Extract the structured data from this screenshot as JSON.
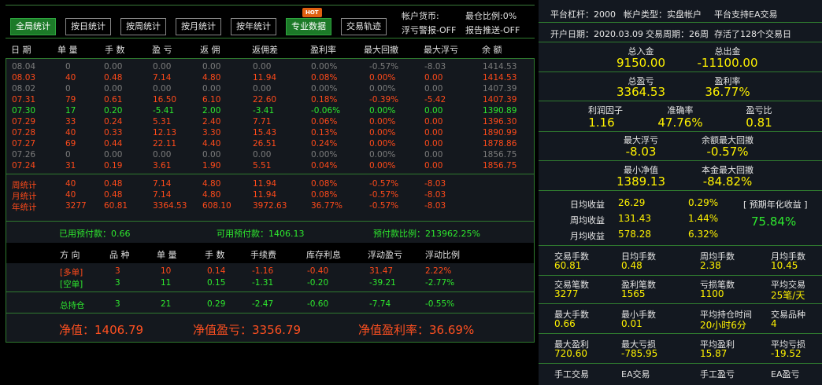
{
  "toolbar": {
    "buttons": [
      "全局统计",
      "按日统计",
      "按周统计",
      "按月统计",
      "按年统计",
      "专业数据",
      "交易轨迹"
    ],
    "hot_badge": "HOT",
    "account_currency": "帐户货币:",
    "min_position_ratio": "最仓比例:0%",
    "floating_loss_alert": "浮亏警报-OFF",
    "report_push": "报告推送-OFF"
  },
  "main_headers": [
    "日 期",
    "单 量",
    "手 数",
    "盈 亏",
    "返 佣",
    "返佣差",
    "盈利率",
    "最大回撤",
    "最大浮亏",
    "余 额"
  ],
  "daily_rows": [
    {
      "tone": "c-gray",
      "cells": [
        "08.04",
        "0",
        "0.00",
        "0.00",
        "0.00",
        "0.00",
        "0.00%",
        "-0.57%",
        "-8.03",
        "1414.53"
      ]
    },
    {
      "tone": "c-red",
      "cells": [
        "08.03",
        "40",
        "0.48",
        "7.14",
        "4.80",
        "11.94",
        "0.08%",
        "0.00%",
        "0.00",
        "1414.53"
      ]
    },
    {
      "tone": "c-gray",
      "cells": [
        "08.02",
        "0",
        "0.00",
        "0.00",
        "0.00",
        "0.00",
        "0.00%",
        "0.00%",
        "0.00",
        "1407.39"
      ]
    },
    {
      "tone": "c-red",
      "cells": [
        "07.31",
        "79",
        "0.61",
        "16.50",
        "6.10",
        "22.60",
        "0.18%",
        "-0.39%",
        "-5.42",
        "1407.39"
      ]
    },
    {
      "tone": "c-green",
      "cells": [
        "07.30",
        "17",
        "0.20",
        "-5.41",
        "2.00",
        "-3.41",
        "-0.06%",
        "0.00%",
        "0.00",
        "1390.89"
      ]
    },
    {
      "tone": "c-red",
      "cells": [
        "07.29",
        "33",
        "0.24",
        "5.31",
        "2.40",
        "7.71",
        "0.06%",
        "0.00%",
        "0.00",
        "1396.30"
      ]
    },
    {
      "tone": "c-red",
      "cells": [
        "07.28",
        "40",
        "0.33",
        "12.13",
        "3.30",
        "15.43",
        "0.13%",
        "0.00%",
        "0.00",
        "1890.99"
      ]
    },
    {
      "tone": "c-red",
      "cells": [
        "07.27",
        "69",
        "0.44",
        "22.11",
        "4.40",
        "26.51",
        "0.24%",
        "0.00%",
        "0.00",
        "1878.86"
      ]
    },
    {
      "tone": "c-gray",
      "cells": [
        "07.26",
        "0",
        "0.00",
        "0.00",
        "0.00",
        "0.00",
        "0.00%",
        "0.00%",
        "0.00",
        "1856.75"
      ]
    },
    {
      "tone": "c-red",
      "cells": [
        "07.24",
        "31",
        "0.19",
        "3.61",
        "1.90",
        "5.51",
        "0.04%",
        "0.00%",
        "0.00",
        "1856.75"
      ]
    }
  ],
  "summary_rows": [
    {
      "cells": [
        "周统计",
        "40",
        "0.48",
        "7.14",
        "4.80",
        "11.94",
        "0.08%",
        "-0.57%",
        "-8.03"
      ]
    },
    {
      "cells": [
        "月统计",
        "40",
        "0.48",
        "7.14",
        "4.80",
        "11.94",
        "0.08%",
        "-0.57%",
        "-8.03"
      ]
    },
    {
      "cells": [
        "年统计",
        "3277",
        "60.81",
        "3364.53",
        "608.10",
        "3972.63",
        "36.77%",
        "-0.57%",
        "-8.03"
      ]
    }
  ],
  "prepayment": {
    "used": "已用预付款：0.66",
    "available": "可用预付款：1406.13",
    "ratio": "预付款比例：213962.25%"
  },
  "position_headers": [
    "方 向",
    "品 种",
    "单 量",
    "手 数",
    "手续费",
    "库存利息",
    "浮动盈亏",
    "浮动比例"
  ],
  "position_rows": [
    {
      "tone": "c-red",
      "cells": [
        "[多单]",
        "3",
        "10",
        "0.14",
        "-1.16",
        "-0.40",
        "31.47",
        "2.22%"
      ]
    },
    {
      "tone": "c-green",
      "cells": [
        "[空单]",
        "3",
        "11",
        "0.15",
        "-1.31",
        "-0.20",
        "-39.21",
        "-2.77%"
      ]
    }
  ],
  "position_total": {
    "tone": "c-green",
    "cells": [
      "总持仓",
      "3",
      "21",
      "0.29",
      "-2.47",
      "-0.60",
      "-7.74",
      "-0.55%"
    ]
  },
  "net": {
    "value": "净值：1406.79",
    "pnl": "净值盈亏：3356.79",
    "rate": "净值盈利率：36.69%"
  },
  "right": {
    "leverage": "平台杠杆：2000",
    "account_type": "帐户类型：实盘帐户",
    "ea_support": "平台支持EA交易",
    "open_date": "开户日期：2020.03.09",
    "trade_cycle": "交易周期：26周",
    "survived": "存活了128个交易日",
    "deposit_label": "总入金",
    "deposit": "9150.00",
    "withdraw_label": "总出金",
    "withdraw": "-11100.00",
    "pnl_label": "总盈亏",
    "pnl": "3364.53",
    "rate_label": "盈利率",
    "rate": "36.77%",
    "profit_factor_label": "利润因子",
    "profit_factor": "1.16",
    "accuracy_label": "准确率",
    "accuracy": "47.76%",
    "pl_ratio_label": "盈亏比",
    "pl_ratio": "0.81",
    "max_float_loss_label": "最大浮亏",
    "max_float_loss": "-8.03",
    "balance_max_dd_label": "余额最大回撤",
    "balance_max_dd": "-0.57%",
    "min_equity_label": "最小净值",
    "min_equity": "1389.13",
    "principal_max_dd_label": "本金最大回撤",
    "principal_max_dd": "-84.82%",
    "daily_label": "日均收益",
    "daily": "26.29",
    "daily_pct": "0.29%",
    "weekly_label": "周均收益",
    "weekly": "131.43",
    "weekly_pct": "1.44%",
    "monthly_label": "月均收益",
    "monthly": "578.28",
    "monthly_pct": "6.32%",
    "annual_label": "[ 预期年化收益 ]",
    "annual": "75.84%",
    "grid": [
      [
        [
          "交易手数",
          "60.81"
        ],
        [
          "日均手数",
          "0.48"
        ],
        [
          "周均手数",
          "2.38"
        ],
        [
          "月均手数",
          "10.45"
        ]
      ],
      [
        [
          "交易笔数",
          "3277"
        ],
        [
          "盈利笔数",
          "1565"
        ],
        [
          "亏损笔数",
          "1100"
        ],
        [
          "平均交易",
          "25笔/天"
        ]
      ],
      [
        [
          "最大手数",
          "0.66"
        ],
        [
          "最小手数",
          "0.01"
        ],
        [
          "平均持仓时间",
          "20小时6分"
        ],
        [
          "交易品种",
          "4"
        ]
      ],
      [
        [
          "最大盈利",
          "720.60"
        ],
        [
          "最大亏损",
          "-785.95"
        ],
        [
          "平均盈利",
          "15.87"
        ],
        [
          "平均亏损",
          "-19.52"
        ]
      ],
      [
        [
          "手工交易",
          ""
        ],
        [
          "EA交易",
          ""
        ],
        [
          "手工盈亏",
          ""
        ],
        [
          "EA盈亏",
          ""
        ]
      ]
    ]
  }
}
